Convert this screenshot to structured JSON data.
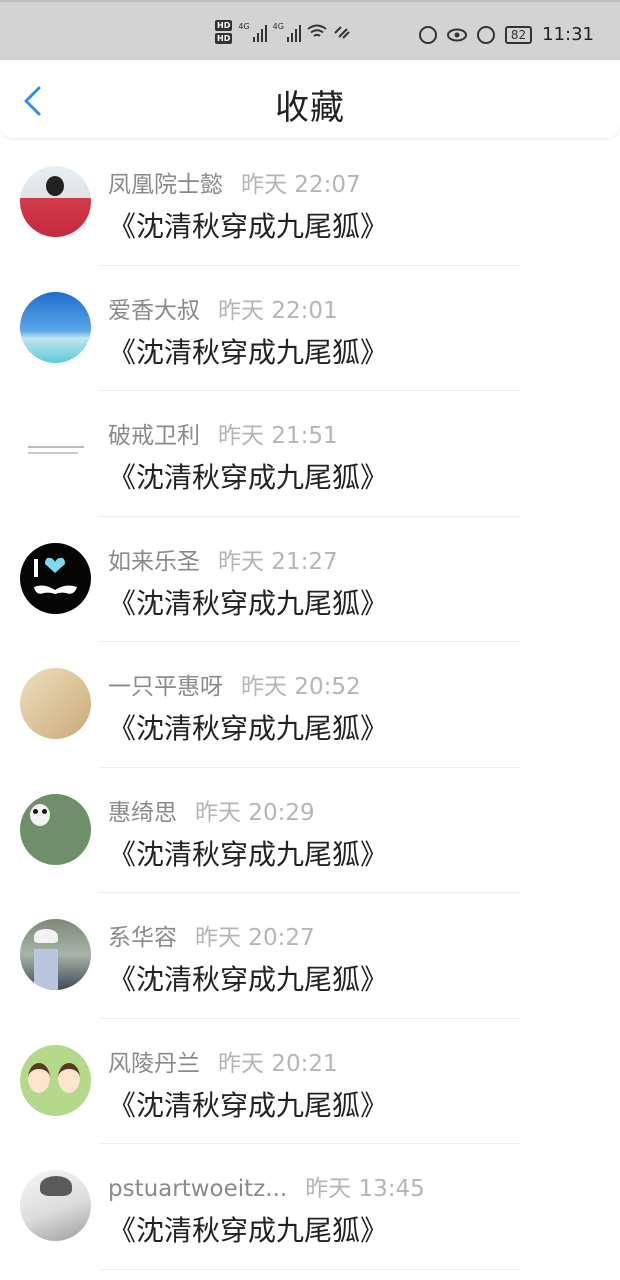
{
  "status_bar": {
    "hd1": "HD",
    "hd2": "HD",
    "sig1_label": "4G",
    "sig2_label": "4G",
    "battery": "82",
    "time": "11:31"
  },
  "header": {
    "title": "收藏",
    "back_icon": "chevron-left-icon"
  },
  "favorites": [
    {
      "name": "凤凰院士懿",
      "time": "昨天 22:07",
      "book": "《沈清秋穿成九尾狐》"
    },
    {
      "name": "爱香大叔",
      "time": "昨天 22:01",
      "book": "《沈清秋穿成九尾狐》"
    },
    {
      "name": "破戒卫利",
      "time": "昨天 21:51",
      "book": "《沈清秋穿成九尾狐》"
    },
    {
      "name": "如来乐圣",
      "time": "昨天 21:27",
      "book": "《沈清秋穿成九尾狐》"
    },
    {
      "name": "一只平惠呀",
      "time": "昨天 20:52",
      "book": "《沈清秋穿成九尾狐》"
    },
    {
      "name": "惠绮思",
      "time": "昨天 20:29",
      "book": "《沈清秋穿成九尾狐》"
    },
    {
      "name": "系华容",
      "time": "昨天 20:27",
      "book": "《沈清秋穿成九尾狐》"
    },
    {
      "name": "风陵丹兰",
      "time": "昨天 20:21",
      "book": "《沈清秋穿成九尾狐》"
    },
    {
      "name": "pstuartwoeitz...",
      "time": "昨天 13:45",
      "book": "《沈清秋穿成九尾狐》"
    }
  ],
  "colors": {
    "accent": "#2f8fe8",
    "status_bar_bg": "#d3d3d3",
    "name_gray": "#8a8a8a",
    "time_gray": "#b5b5b5"
  }
}
